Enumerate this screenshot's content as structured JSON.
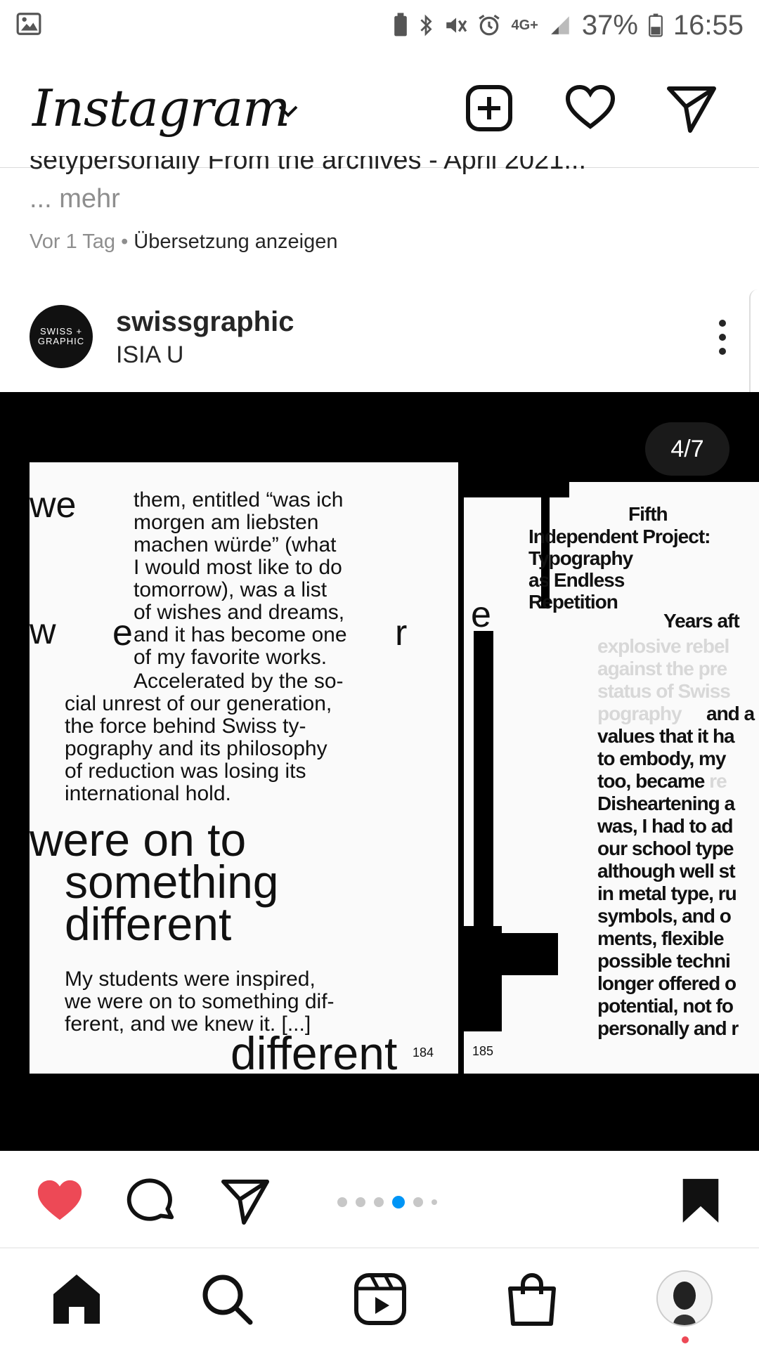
{
  "status_bar": {
    "battery": "37%",
    "time": "16:55",
    "network": "4G+"
  },
  "header": {
    "logo": "Instagram"
  },
  "previous_post": {
    "caption_cut": "setypersonally From the archives - April 2021...",
    "more_label": "... mehr",
    "time_ago": "Vor 1 Tag",
    "separator": " • ",
    "translate_label": "Übersetzung anzeigen"
  },
  "post": {
    "avatar_text_1": "SWISS +",
    "avatar_text_2": "GRAPHIC",
    "username": "swissgraphic",
    "location": "ISIA U",
    "counter": "4/7",
    "carousel_total": 6,
    "carousel_active_index": 3
  },
  "media": {
    "left_page": {
      "margin_top": "we",
      "margin_mid_a": "w",
      "margin_mid_b": "e",
      "margin_mid_c": "r",
      "p1_lines": [
        "them, entitled “was ich",
        "morgen am liebsten",
        "machen würde” (what",
        "I would most like to do",
        "tomorrow), was a list",
        "of wishes and dreams,",
        "and it has become one",
        "of my favorite works."
      ],
      "p2_lines": [
        "Accelerated by the so-",
        "cial unrest of our generation,",
        "the force behind Swiss ty-",
        "pography and its philosophy",
        "of reduction was losing its",
        "international hold."
      ],
      "big_lines": [
        "were on to",
        "something",
        "different"
      ],
      "p3_lines": [
        "My students were inspired,",
        "we were on to something dif-",
        "ferent, and we knew it. [...]"
      ],
      "footer_big": "different",
      "page_num_a": "184",
      "page_num_b": "185"
    },
    "right_page": {
      "margin_letter": "e",
      "heading_lines": [
        "Fifth",
        "Independent Project:",
        "Typography",
        "as Endless",
        "Repetition"
      ],
      "sub_heading": "Years aft",
      "faded_lines": [
        "explosive rebel",
        "against the pre",
        "status of Swiss",
        "pography"
      ],
      "body_lines": [
        "and a",
        "values that it ha",
        "to embody, my",
        "too, became",
        "Disheartening a",
        "was, I had to ad",
        "our school type",
        "although well st",
        "in metal type, ru",
        "symbols, and o",
        "ments, flexible",
        "possible techni",
        "longer offered o",
        "potential, not fo",
        "personally and r"
      ],
      "faded_tail": "re"
    }
  },
  "colors": {
    "like": "#ed4956",
    "accent_dot": "#0095f6"
  },
  "nav": {
    "items": [
      "home-icon",
      "search-icon",
      "reels-icon",
      "shop-icon",
      "profile-avatar"
    ]
  }
}
